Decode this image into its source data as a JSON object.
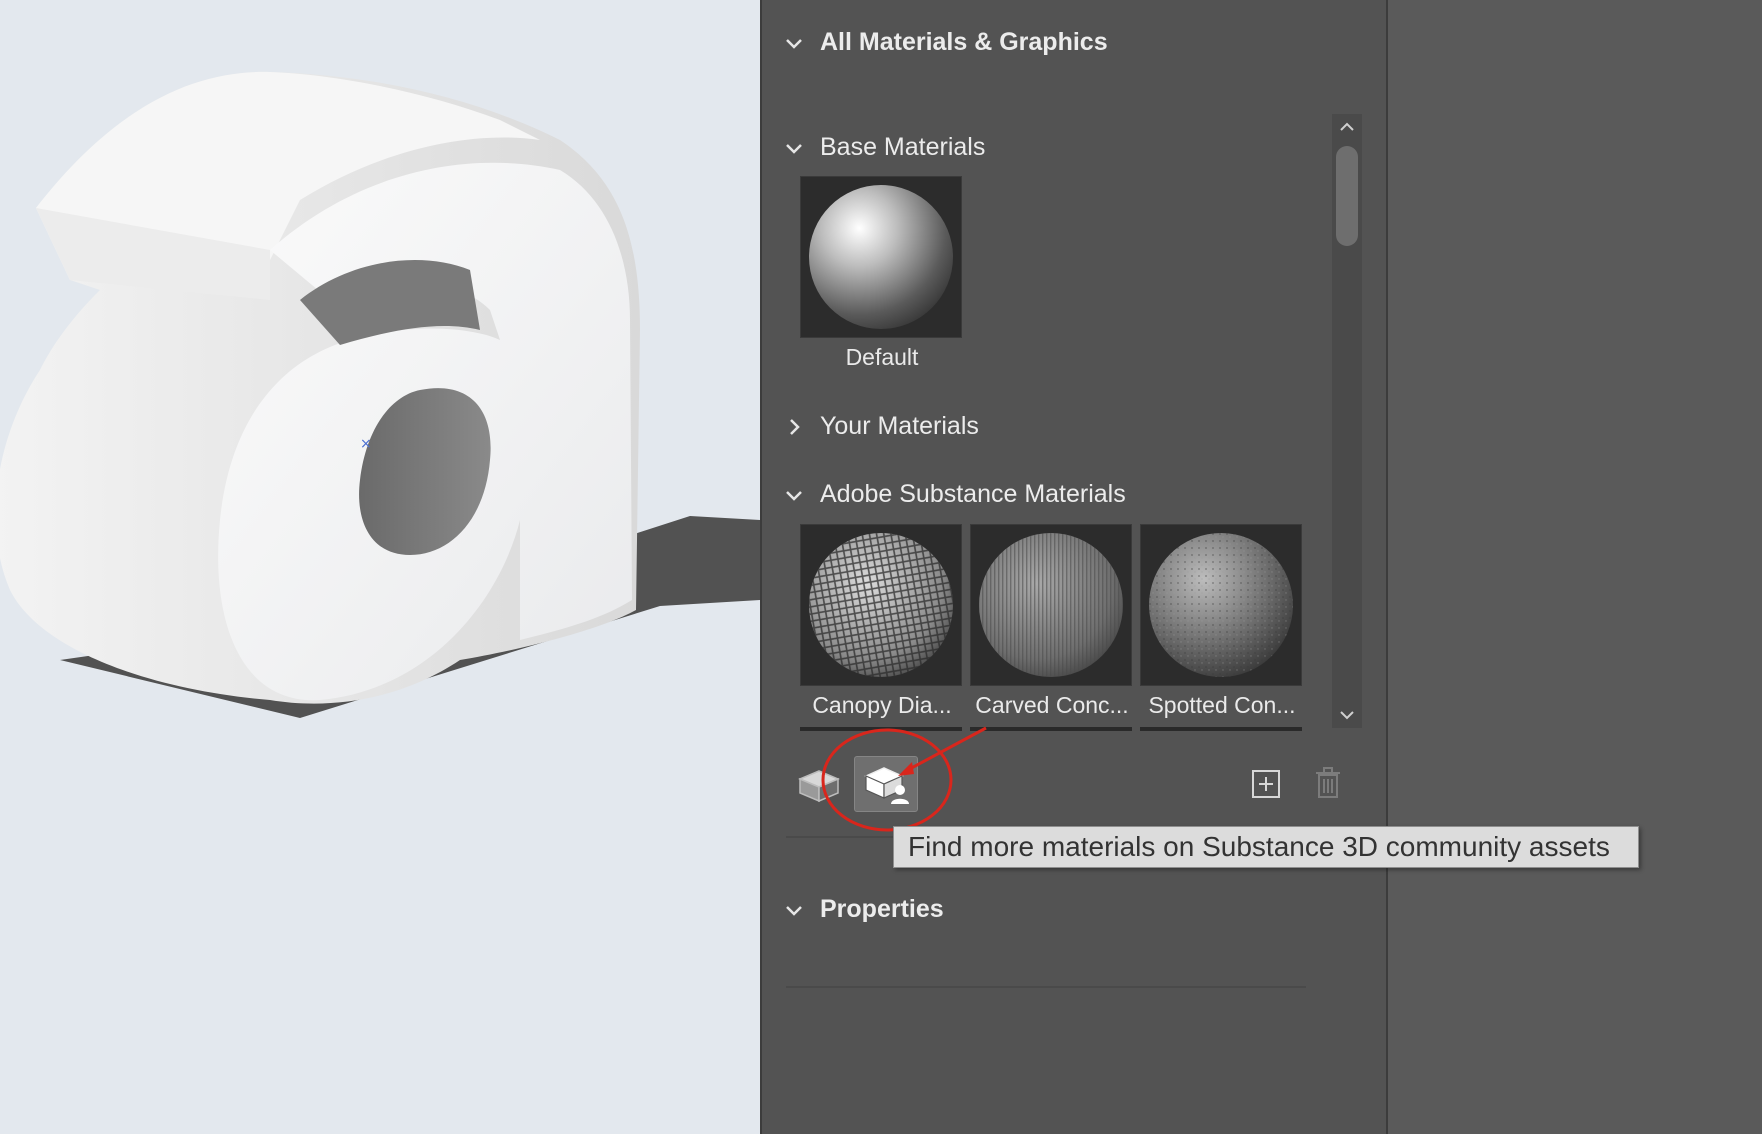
{
  "panel": {
    "all_header": "All Materials & Graphics",
    "base_header": "Base Materials",
    "your_header": "Your Materials",
    "adobe_header": "Adobe Substance Materials",
    "properties_header": "Properties"
  },
  "base_materials": [
    {
      "label": "Default"
    }
  ],
  "adobe_materials": [
    {
      "label": "Canopy Dia..."
    },
    {
      "label": "Carved Conc..."
    },
    {
      "label": "Spotted Con..."
    }
  ],
  "toolbar": {
    "materials_icon": "cube-materials-icon",
    "community_icon": "cube-community-icon",
    "add_icon": "add-square-icon",
    "delete_icon": "trash-icon"
  },
  "tooltip": {
    "text": "Find more materials on Substance 3D community assets"
  },
  "colors": {
    "canvas_bg": "#e3e8ee",
    "panel_bg": "#535353",
    "annotation_red": "#d9261c",
    "tooltip_bg": "#dcdcdc"
  }
}
